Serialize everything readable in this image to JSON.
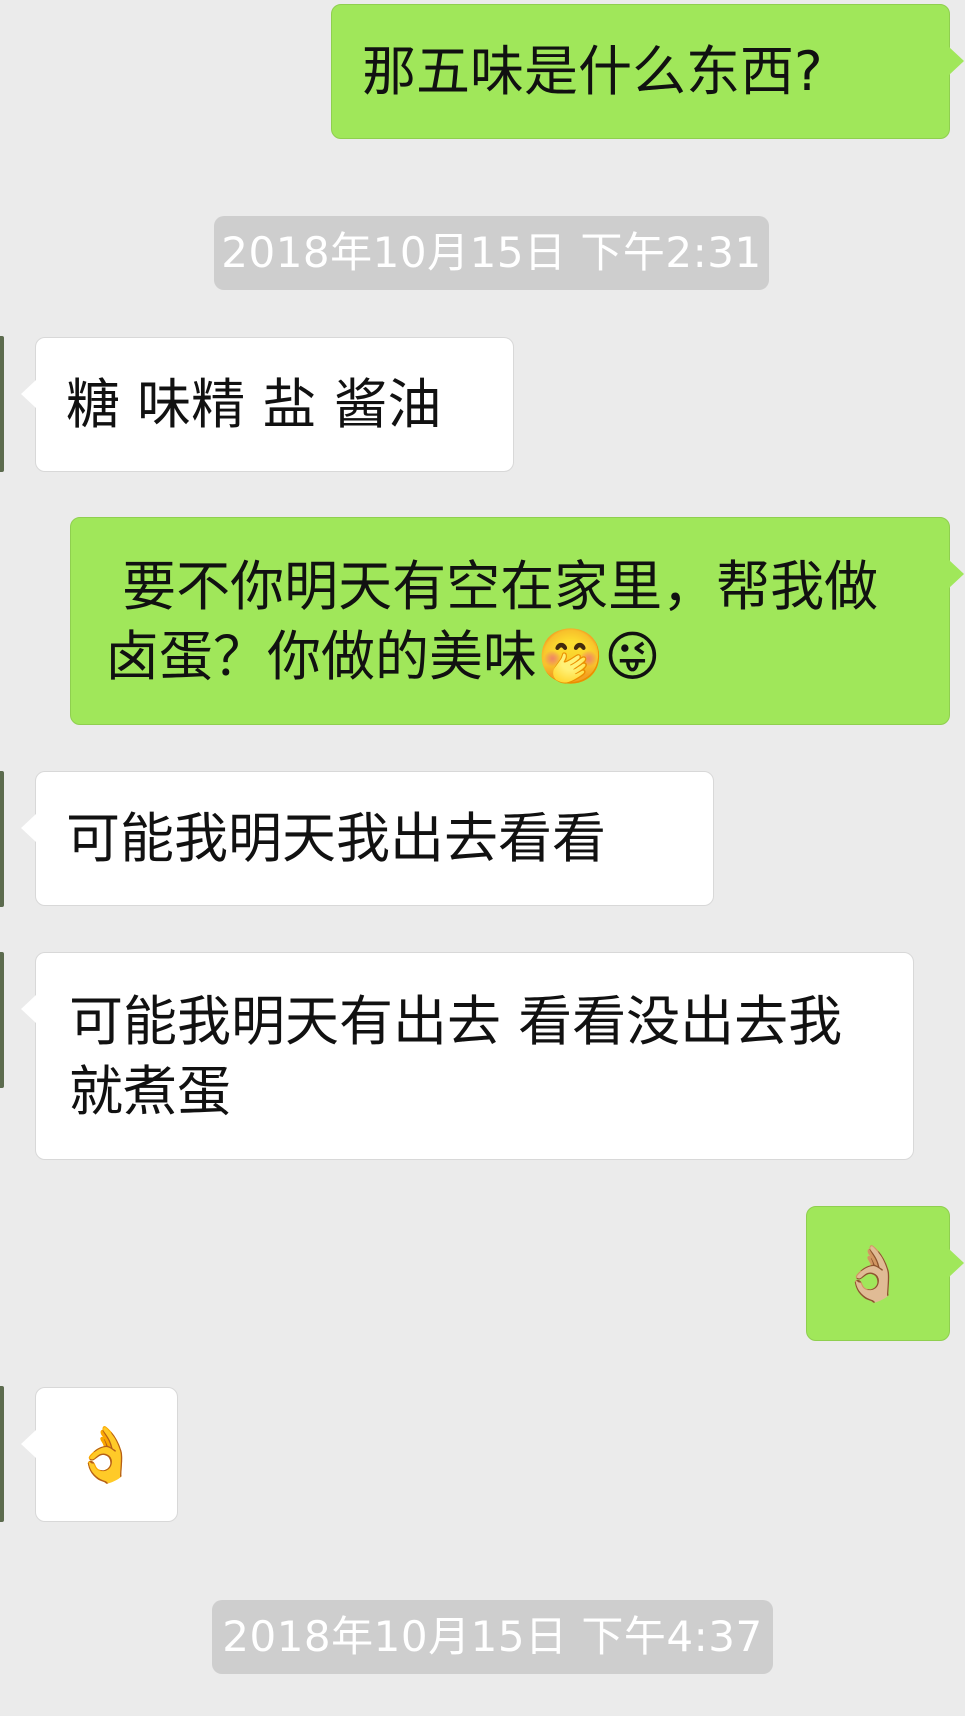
{
  "messages": [
    {
      "side": "out",
      "text": "那五味是什么东西?"
    },
    {
      "side": "in",
      "text": "糖 味精 盐 酱油"
    },
    {
      "side": "out",
      "text": " 要不你明天有空在家里，帮我做卤蛋？你做的美味",
      "emojis": [
        "🤭",
        "😜"
      ]
    },
    {
      "side": "in",
      "text": "可能我明天我出去看看"
    },
    {
      "side": "in",
      "text": "可能我明天有出去 看看没出去我就煮蛋"
    },
    {
      "side": "out",
      "text": "👌🏼"
    },
    {
      "side": "in",
      "text": "👌"
    }
  ],
  "timestamps": [
    "2018年10月15日 下午2:31",
    "2018年10月15日 下午4:37"
  ],
  "colors": {
    "background": "#ebebeb",
    "outgoing_bubble": "#a0e75a",
    "incoming_bubble": "#ffffff",
    "timestamp_bg": "#cecece",
    "timestamp_text": "#ffffff"
  }
}
